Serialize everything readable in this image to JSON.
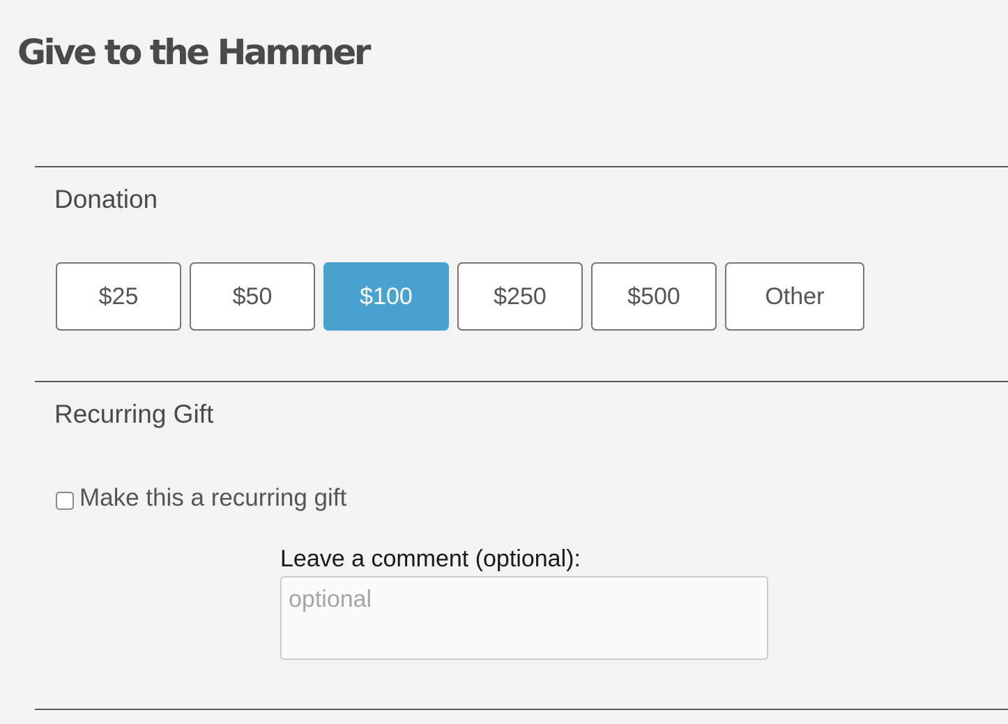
{
  "header": {
    "title": "Give to the Hammer"
  },
  "donation": {
    "heading": "Donation",
    "selected_index": 2,
    "amounts": [
      {
        "label": "$25"
      },
      {
        "label": "$50"
      },
      {
        "label": "$100"
      },
      {
        "label": "$250"
      },
      {
        "label": "$500"
      },
      {
        "label": "Other"
      }
    ]
  },
  "recurring": {
    "heading": "Recurring Gift",
    "checkbox_label": "Make this a recurring gift",
    "checked": false
  },
  "comment": {
    "label": "Leave a comment (optional):",
    "placeholder": "optional",
    "value": ""
  },
  "colors": {
    "background": "#f3f3f3",
    "text": "#4a4a4a",
    "accent": "#4aa3cf",
    "divider": "#5a5a5a"
  }
}
